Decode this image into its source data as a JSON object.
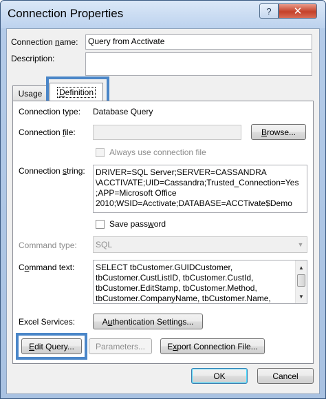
{
  "window": {
    "title": "Connection Properties",
    "close_glyph": "✕",
    "help_glyph": "?"
  },
  "connection_name": {
    "label_pre": "Connection ",
    "label_key": "n",
    "label_post": "ame:",
    "value": "Query from Acctivate"
  },
  "description": {
    "label": "Description:",
    "value": ""
  },
  "tabs": [
    {
      "label_pre": "Usa",
      "label_key": "g",
      "label_post": "e"
    },
    {
      "label_pre": "",
      "label_key": "D",
      "label_post": "efinition"
    }
  ],
  "definition": {
    "connection_type": {
      "label": "Connection type:",
      "value": "Database Query"
    },
    "connection_file": {
      "label_pre": "Connection ",
      "label_key": "f",
      "label_post": "ile:",
      "value": "",
      "browse_pre": "",
      "browse_key": "B",
      "browse_post": "rowse..."
    },
    "always_use_file": {
      "label": "Always use connection file",
      "checked": false
    },
    "connection_string": {
      "label_pre": "Connection ",
      "label_key": "s",
      "label_post": "tring:",
      "lines": [
        "DRIVER=SQL Server;SERVER=CASSANDRA",
        "\\ACCTIVATE;UID=Cassandra;Trusted_Connection=Yes",
        ";APP=Microsoft Office",
        "2010;WSID=Acctivate;DATABASE=ACCTivate$Demo"
      ]
    },
    "save_password": {
      "label_pre": "Save pass",
      "label_key": "w",
      "label_post": "ord",
      "checked": false
    },
    "command_type": {
      "label": "Command type:",
      "value": "SQL"
    },
    "command_text": {
      "label_pre": "C",
      "label_key": "o",
      "label_post": "mmand text:",
      "lines": [
        "SELECT tbCustomer.GUIDCustomer,",
        "tbCustomer.CustListID, tbCustomer.CustId,",
        "tbCustomer.EditStamp, tbCustomer.Method,",
        "tbCustomer.CompanyName, tbCustomer.Name,"
      ]
    },
    "excel_services": {
      "label": "Excel Services:",
      "button_pre": "A",
      "button_key": "u",
      "button_post": "thentication Settings..."
    },
    "edit_query_pre": "",
    "edit_query_key": "E",
    "edit_query_post": "dit Query...",
    "parameters_label": "Parameters...",
    "export_pre": "E",
    "export_key": "x",
    "export_post": "port Connection File..."
  },
  "footer": {
    "ok": "OK",
    "cancel": "Cancel"
  },
  "colors": {
    "highlight": "#4a86c8",
    "title_gradient_top": "#dbe8f7",
    "close_red": "#c4412a"
  }
}
